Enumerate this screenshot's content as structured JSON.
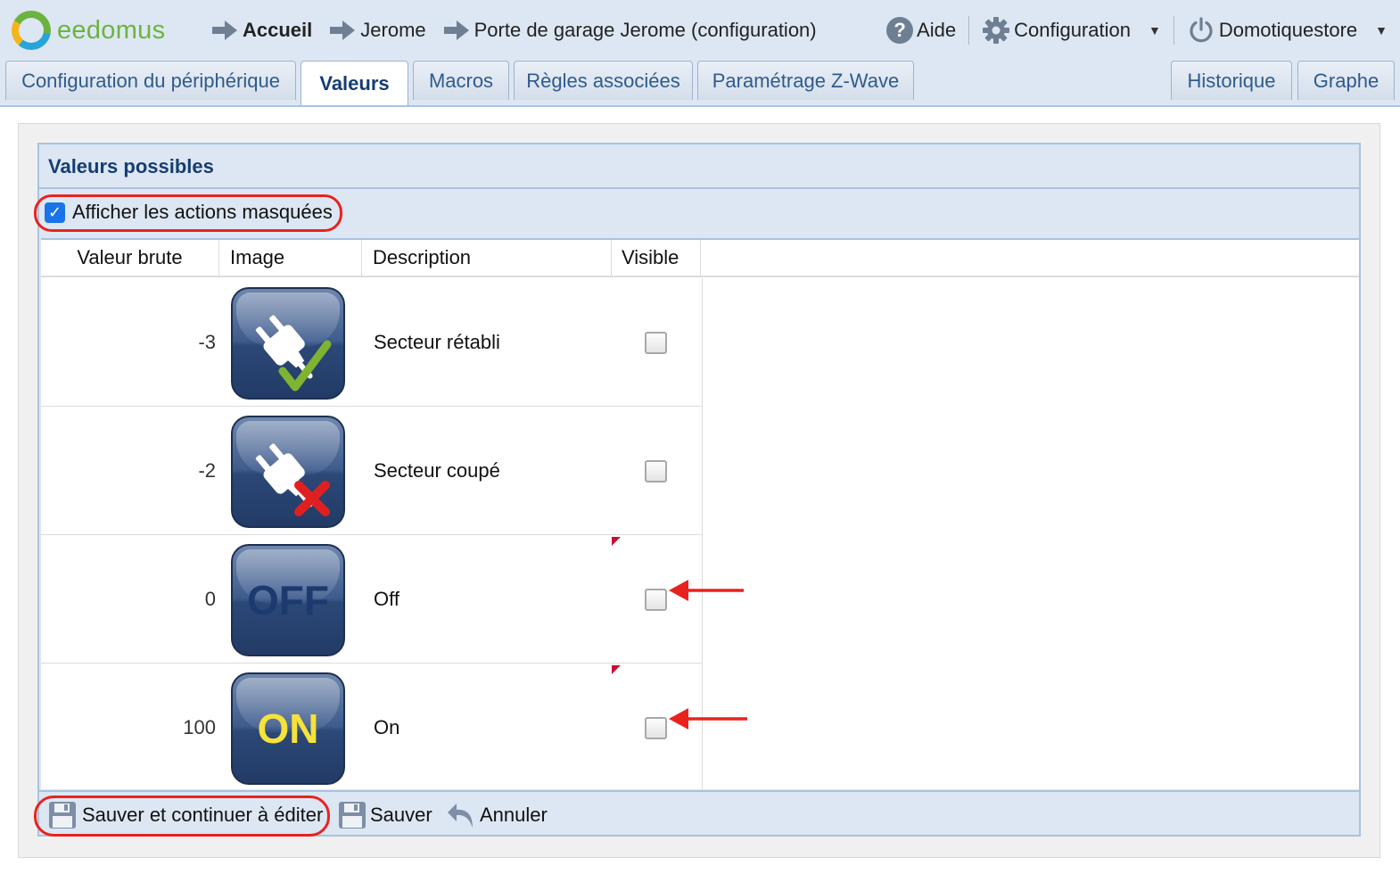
{
  "app": {
    "logo_text": "eedomus"
  },
  "breadcrumbs": [
    {
      "label": "Accueil"
    },
    {
      "label": "Jerome"
    },
    {
      "label": "Porte de garage Jerome (configuration)"
    }
  ],
  "topmenu": {
    "help": "Aide",
    "config": "Configuration",
    "user": "Domotiquestore"
  },
  "tabs": [
    {
      "label": "Configuration du périphérique"
    },
    {
      "label": "Valeurs"
    },
    {
      "label": "Macros"
    },
    {
      "label": "Règles associées"
    },
    {
      "label": "Paramétrage Z-Wave"
    },
    {
      "label": "Historique"
    },
    {
      "label": "Graphe"
    }
  ],
  "panel": {
    "title": "Valeurs possibles",
    "show_hidden_label": "Afficher les actions masquées",
    "show_hidden_checked": true
  },
  "table": {
    "headers": [
      "Valeur brute",
      "Image",
      "Description",
      "Visible"
    ],
    "rows": [
      {
        "raw": "-3",
        "image": "plug-check-icon",
        "description": "Secteur rétabli",
        "visible": false
      },
      {
        "raw": "-2",
        "image": "plug-cross-icon",
        "description": "Secteur coupé",
        "visible": false
      },
      {
        "raw": "0",
        "image_text": "OFF",
        "description": "Off",
        "visible": false
      },
      {
        "raw": "100",
        "image_text": "ON",
        "description": "On",
        "visible": false
      }
    ]
  },
  "footer": {
    "save_continue": "Sauver et continuer à éditer",
    "save": "Sauver",
    "cancel": "Annuler"
  },
  "colors": {
    "accent_blue": "#163d72",
    "panel_bg": "#dde7f3",
    "highlight_red": "#e8231f",
    "logo_green": "#6cb33e"
  }
}
